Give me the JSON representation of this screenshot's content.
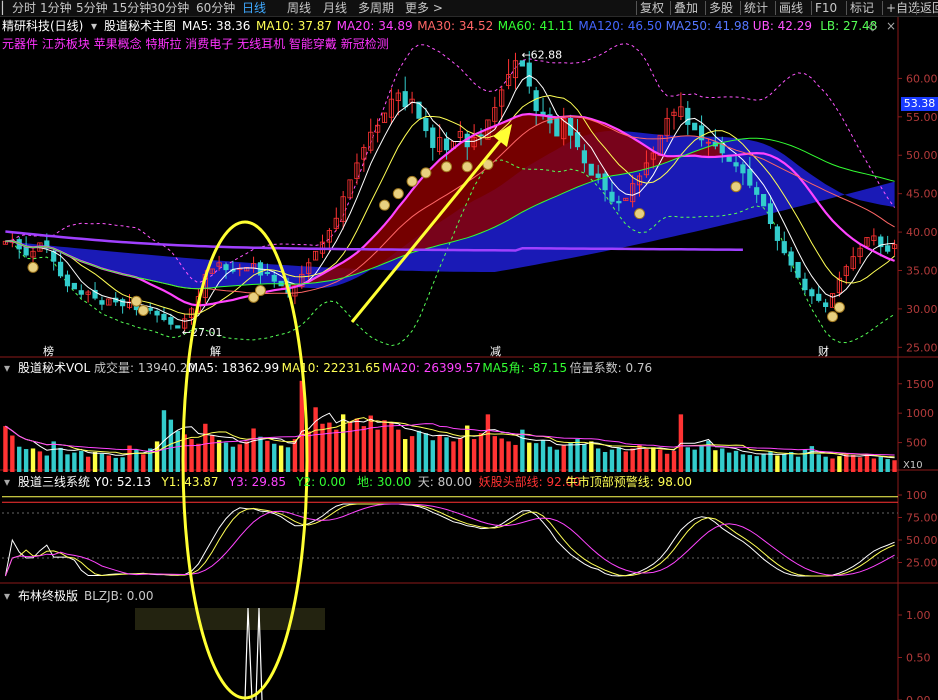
{
  "toolbar": {
    "left": [
      "分时",
      "1分钟",
      "5分钟",
      "15分钟",
      "30分钟",
      "60分钟",
      "日线",
      "周线",
      "月线",
      "多周期",
      "更多 >"
    ],
    "active": "日线",
    "right": [
      "复权",
      "叠加",
      "多股",
      "统计",
      "画线",
      "F10",
      "标记",
      "+自选",
      "返回"
    ]
  },
  "colors": {
    "ma5": "#ffffff",
    "ma10": "#ffff55",
    "ma20": "#ff44ff",
    "ma30": "#ff6666",
    "ma60": "#33ff33",
    "ma120": "#4466ff",
    "ma250": "#5577ff",
    "up": "#ff3333",
    "down": "#33cccc",
    "ub": "#ff55ff",
    "lb": "#55ff55",
    "arrow": "#ffff33"
  },
  "main": {
    "stock_title": "精研科技(日线)",
    "indicator_name": "股道秘术主图",
    "ma_labels": [
      {
        "text": "MA5: 38.36",
        "color": "#ffffff"
      },
      {
        "text": "MA10: 37.87",
        "color": "#ffff55"
      },
      {
        "text": "MA20: 34.89",
        "color": "#ff44ff"
      },
      {
        "text": "MA30: 34.52",
        "color": "#ff6666"
      },
      {
        "text": "MA60: 41.11",
        "color": "#33ff33"
      },
      {
        "text": "MA120: 46.50",
        "color": "#4466ff"
      },
      {
        "text": "MA250: 41.98",
        "color": "#5577ff"
      },
      {
        "text": "UB: 42.29",
        "color": "#ff55ff"
      },
      {
        "text": "LB: 27.48",
        "color": "#55ff55"
      }
    ],
    "concepts": "元器件 江苏板块 苹果概念 特斯拉 消费电子 无线耳机 智能穿戴 新冠检测",
    "current_price": "53.38",
    "high_label": "62.88",
    "low_label": "27.01",
    "event_marks": [
      {
        "text": "榜",
        "x": 43
      },
      {
        "text": "解",
        "x": 210
      },
      {
        "text": "减",
        "x": 490
      },
      {
        "text": "财",
        "x": 818
      }
    ]
  },
  "vol": {
    "name": "股道秘术VOL",
    "labels": [
      {
        "text": "成交量: 13940.20",
        "color": "#c8c8c8"
      },
      {
        "text": "MA5: 18362.99",
        "color": "#ffffff"
      },
      {
        "text": "MA10: 22231.65",
        "color": "#ffff55"
      },
      {
        "text": "MA20: 26399.57",
        "color": "#ff44ff"
      },
      {
        "text": "MA5角: -87.15",
        "color": "#33ff33"
      },
      {
        "text": "倍量系数: 0.76",
        "color": "#c8c8c8"
      }
    ],
    "unit": "X10"
  },
  "three": {
    "name": "股道三线系统",
    "labels": [
      {
        "text": "Y0: 52.13",
        "color": "#ffffff"
      },
      {
        "text": "Y1: 43.87",
        "color": "#ffff55"
      },
      {
        "text": "Y3: 29.85",
        "color": "#ff44ff"
      },
      {
        "text": "Y2: 0.00",
        "color": "#33ff33"
      },
      {
        "text": "地: 30.00",
        "color": "#33ff33"
      },
      {
        "text": "天: 80.00",
        "color": "#c8c8c8"
      },
      {
        "text": "妖股头部线: 92.00",
        "color": "#ff3333"
      },
      {
        "text": "牛市顶部预警线: 98.00",
        "color": "#ffff55"
      }
    ]
  },
  "boll": {
    "name": "布林终极版",
    "labels": [
      {
        "text": "BLZJB: 0.00",
        "color": "#c8c8c8"
      }
    ]
  },
  "chart_data": [
    {
      "type": "candlestick",
      "panel": "main",
      "ylim": [
        24,
        65
      ],
      "y_ticks": [
        "25.00",
        "30.00",
        "35.00",
        "40.00",
        "45.00",
        "50.00",
        "55.00",
        "60.00"
      ],
      "close": [
        38.8,
        38.9,
        37.8,
        37.0,
        37.5,
        38.6,
        37.9,
        36.2,
        34.3,
        33.0,
        32.6,
        31.9,
        32.2,
        31.4,
        30.6,
        31.3,
        30.9,
        30.4,
        30.9,
        29.9,
        30.4,
        29.8,
        29.2,
        28.6,
        28.0,
        27.5,
        28.7,
        30.0,
        31.6,
        34.5,
        35.2,
        36.0,
        35.1,
        34.9,
        35.3,
        35.4,
        35.9,
        34.4,
        34.6,
        33.6,
        33.0,
        32.0,
        33.0,
        34.5,
        36.0,
        37.5,
        38.7,
        40.2,
        41.8,
        44.6,
        46.8,
        49.0,
        51.0,
        53.0,
        53.9,
        55.5,
        57.3,
        58.1,
        56.3,
        57.3,
        54.8,
        53.2,
        51.0,
        52.3,
        50.7,
        51.8,
        53.1,
        51.1,
        52.3,
        52.6,
        54.6,
        56.2,
        58.5,
        60.5,
        62.3,
        61.6,
        59.0,
        55.8,
        55.1,
        54.2,
        52.5,
        54.8,
        52.6,
        51.1,
        49.0,
        47.4,
        47.1,
        45.5,
        44.0,
        43.8,
        44.4,
        46.3,
        47.3,
        49.0,
        50.3,
        52.6,
        54.8,
        55.6,
        56.3,
        54.0,
        53.3,
        52.0,
        51.7,
        51.2,
        50.3,
        49.2,
        48.6,
        47.7,
        46.1,
        44.9,
        43.4,
        41.1,
        38.9,
        37.3,
        35.7,
        34.1,
        32.5,
        31.7,
        31.1,
        30.3,
        32.0,
        34.0,
        35.5,
        36.8,
        37.9,
        39.3,
        39.5,
        38.1,
        37.5,
        38.36
      ],
      "ma_series": [
        "MA5",
        "MA10",
        "MA20",
        "MA30",
        "MA60",
        "MA120",
        "MA250",
        "UB",
        "LB"
      ]
    },
    {
      "type": "bar",
      "panel": "volume",
      "ylim": [
        0,
        1700
      ],
      "y_ticks": [
        "500",
        "1000",
        "1500"
      ],
      "values": [
        780,
        620,
        430,
        390,
        400,
        350,
        280,
        520,
        410,
        300,
        330,
        360,
        260,
        340,
        310,
        280,
        240,
        250,
        450,
        380,
        300,
        400,
        520,
        1050,
        890,
        700,
        640,
        560,
        480,
        820,
        620,
        540,
        500,
        430,
        470,
        520,
        740,
        600,
        530,
        480,
        450,
        420,
        560,
        1550,
        690,
        1100,
        820,
        840,
        720,
        980,
        860,
        910,
        780,
        960,
        720,
        880,
        830,
        720,
        560,
        610,
        700,
        660,
        540,
        620,
        590,
        520,
        580,
        790,
        560,
        660,
        980,
        610,
        570,
        520,
        460,
        720,
        500,
        490,
        540,
        430,
        380,
        450,
        500,
        560,
        470,
        520,
        400,
        340,
        380,
        420,
        350,
        400,
        460,
        390,
        420,
        380,
        310,
        360,
        980,
        420,
        380,
        450,
        530,
        370,
        400,
        330,
        360,
        300,
        290,
        270,
        310,
        350,
        280,
        300,
        340,
        260,
        380,
        440,
        300,
        260,
        230,
        270,
        310,
        290,
        250,
        300,
        230,
        260,
        220,
        200
      ]
    },
    {
      "type": "line",
      "panel": "three-line",
      "ylim": [
        0,
        110
      ],
      "y_ticks": [
        "25.00",
        "50.00",
        "75.00",
        "100"
      ],
      "reference_lines": [
        {
          "name": "妖股头部线",
          "value": 92
        },
        {
          "name": "牛市顶部预警线",
          "value": 98
        },
        {
          "name": "天",
          "value": 80
        },
        {
          "name": "地",
          "value": 30
        }
      ],
      "series": [
        {
          "name": "Y0",
          "color": "#ffffff"
        },
        {
          "name": "Y1",
          "color": "#ffff55"
        },
        {
          "name": "Y3",
          "color": "#ff44ff"
        }
      ]
    },
    {
      "type": "line",
      "panel": "boll",
      "ylim": [
        0,
        1.2
      ],
      "y_ticks": [
        "1.00",
        "0.50",
        "0.00"
      ]
    }
  ]
}
